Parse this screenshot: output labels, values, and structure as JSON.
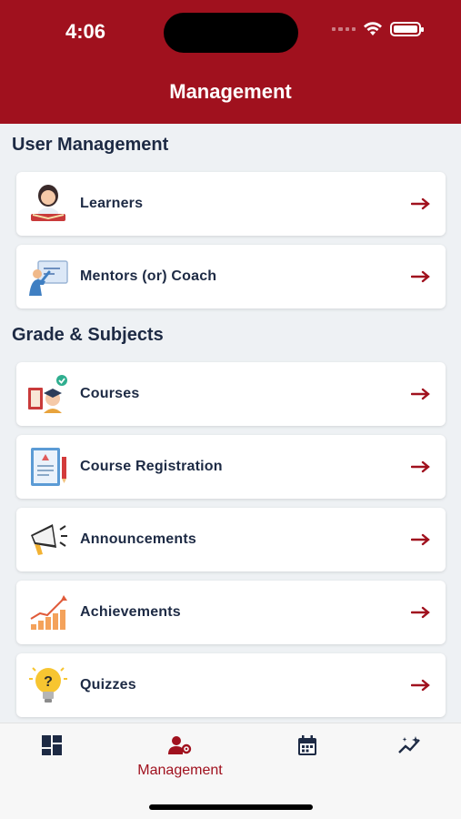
{
  "status_bar": {
    "time": "4:06"
  },
  "header": {
    "title": "Management"
  },
  "sections": [
    {
      "title": "User Management",
      "items": [
        {
          "label": "Learners",
          "icon": "learner-reading-icon"
        },
        {
          "label": "Mentors (or) Coach",
          "icon": "mentor-whiteboard-icon"
        }
      ]
    },
    {
      "title": "Grade & Subjects",
      "items": [
        {
          "label": "Courses",
          "icon": "courses-graduate-icon"
        },
        {
          "label": "Course Registration",
          "icon": "registration-form-icon"
        },
        {
          "label": "Announcements",
          "icon": "megaphone-icon"
        },
        {
          "label": "Achievements",
          "icon": "growth-chart-icon"
        },
        {
          "label": "Quizzes",
          "icon": "question-bulb-icon"
        }
      ]
    }
  ],
  "tabbar": {
    "tabs": [
      {
        "label": "",
        "icon": "dashboard-icon"
      },
      {
        "label": "Management",
        "icon": "user-gear-icon",
        "active": true
      },
      {
        "label": "",
        "icon": "calendar-icon"
      },
      {
        "label": "",
        "icon": "sparkle-chart-icon"
      }
    ]
  },
  "colors": {
    "brand": "#a0111e",
    "text": "#1d2a44",
    "background": "#eef1f4"
  }
}
